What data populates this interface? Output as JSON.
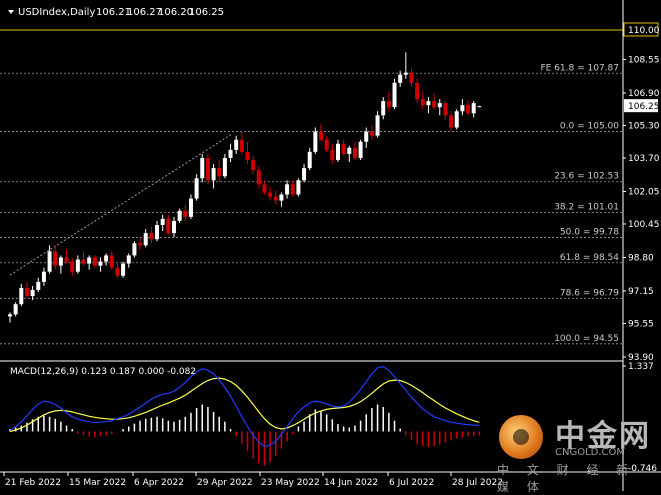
{
  "window": {
    "title": "USDIndex,Daily",
    "ohlc": [
      "106.21",
      "106.27",
      "106.20",
      "106.25"
    ]
  },
  "chart_data": {
    "type": "candlestick",
    "price_axis": {
      "ylim": [
        93.9,
        110.0
      ],
      "ticks": [
        "110.00",
        "108.55",
        "106.90",
        "105.30",
        "103.70",
        "102.05",
        "100.45",
        "98.80",
        "97.15",
        "95.55",
        "93.90"
      ],
      "current_price": "106.25"
    },
    "date_axis": {
      "ticks": [
        "21 Feb 2022",
        "15 Mar 2022",
        "6 Apr 2022",
        "29 Apr 2022",
        "23 May 2022",
        "14 Jun 2022",
        "6 Jul 2022",
        "28 Jul 2022"
      ]
    },
    "candles": [
      [
        95.9,
        96.1,
        95.6,
        96.0
      ],
      [
        96.0,
        96.6,
        95.9,
        96.5
      ],
      [
        96.5,
        97.5,
        96.4,
        97.3
      ],
      [
        97.3,
        97.6,
        96.8,
        96.9
      ],
      [
        96.9,
        97.4,
        96.7,
        97.2
      ],
      [
        97.2,
        97.8,
        97.1,
        97.6
      ],
      [
        97.6,
        98.3,
        97.4,
        98.1
      ],
      [
        98.1,
        99.4,
        98.0,
        99.1
      ],
      [
        99.1,
        99.4,
        98.2,
        98.4
      ],
      [
        98.4,
        98.9,
        98.0,
        98.8
      ],
      [
        98.8,
        99.2,
        98.5,
        98.6
      ],
      [
        98.6,
        98.8,
        97.9,
        98.1
      ],
      [
        98.1,
        98.9,
        98.0,
        98.7
      ],
      [
        98.7,
        99.1,
        98.4,
        98.5
      ],
      [
        98.5,
        98.9,
        98.2,
        98.8
      ],
      [
        98.8,
        98.9,
        98.3,
        98.4
      ],
      [
        98.4,
        98.8,
        98.1,
        98.6
      ],
      [
        98.6,
        99.0,
        98.4,
        98.9
      ],
      [
        98.9,
        99.1,
        98.2,
        98.3
      ],
      [
        98.3,
        98.5,
        97.8,
        97.9
      ],
      [
        97.9,
        98.6,
        97.8,
        98.5
      ],
      [
        98.5,
        99.0,
        98.3,
        98.9
      ],
      [
        98.9,
        99.6,
        98.8,
        99.5
      ],
      [
        99.5,
        99.8,
        99.2,
        99.4
      ],
      [
        99.4,
        100.2,
        99.3,
        100.0
      ],
      [
        100.0,
        100.3,
        99.5,
        99.7
      ],
      [
        99.7,
        100.6,
        99.6,
        100.4
      ],
      [
        100.4,
        100.9,
        100.1,
        100.7
      ],
      [
        100.7,
        100.9,
        99.9,
        100.0
      ],
      [
        100.0,
        100.8,
        99.8,
        100.6
      ],
      [
        100.6,
        101.2,
        100.5,
        101.1
      ],
      [
        101.1,
        101.4,
        100.6,
        100.8
      ],
      [
        100.8,
        101.9,
        100.7,
        101.7
      ],
      [
        101.7,
        102.9,
        101.6,
        102.7
      ],
      [
        102.7,
        103.9,
        102.5,
        103.7
      ],
      [
        103.7,
        103.9,
        102.4,
        102.6
      ],
      [
        102.6,
        103.4,
        102.2,
        103.2
      ],
      [
        103.2,
        103.6,
        102.5,
        102.8
      ],
      [
        102.8,
        103.9,
        102.7,
        103.7
      ],
      [
        103.7,
        104.4,
        103.5,
        104.1
      ],
      [
        104.1,
        104.8,
        103.9,
        104.6
      ],
      [
        104.6,
        105.0,
        103.9,
        104.0
      ],
      [
        104.0,
        104.5,
        103.4,
        103.6
      ],
      [
        103.6,
        103.8,
        102.9,
        103.1
      ],
      [
        103.1,
        103.3,
        102.2,
        102.4
      ],
      [
        102.4,
        102.6,
        101.9,
        102.0
      ],
      [
        102.0,
        102.3,
        101.6,
        101.8
      ],
      [
        101.8,
        102.1,
        101.4,
        101.6
      ],
      [
        101.6,
        102.0,
        101.3,
        101.9
      ],
      [
        101.9,
        102.6,
        101.7,
        102.4
      ],
      [
        102.4,
        102.6,
        101.8,
        101.9
      ],
      [
        101.9,
        102.7,
        101.8,
        102.6
      ],
      [
        102.6,
        103.4,
        102.5,
        103.2
      ],
      [
        103.2,
        104.2,
        103.1,
        104.0
      ],
      [
        104.0,
        105.2,
        103.9,
        105.0
      ],
      [
        105.0,
        105.4,
        104.5,
        104.6
      ],
      [
        104.6,
        104.8,
        104.0,
        104.1
      ],
      [
        104.1,
        104.4,
        103.4,
        103.6
      ],
      [
        103.6,
        104.6,
        103.5,
        104.4
      ],
      [
        104.4,
        104.6,
        103.8,
        103.9
      ],
      [
        103.9,
        104.3,
        103.5,
        104.2
      ],
      [
        104.2,
        104.5,
        103.6,
        103.7
      ],
      [
        103.7,
        104.6,
        103.6,
        104.5
      ],
      [
        104.5,
        105.2,
        104.2,
        105.0
      ],
      [
        105.0,
        105.3,
        104.6,
        104.8
      ],
      [
        104.8,
        106.0,
        104.7,
        105.8
      ],
      [
        105.8,
        106.7,
        105.6,
        106.5
      ],
      [
        106.5,
        107.0,
        106.0,
        106.2
      ],
      [
        106.2,
        107.6,
        106.1,
        107.4
      ],
      [
        107.4,
        108.0,
        107.2,
        107.8
      ],
      [
        107.8,
        108.9,
        107.6,
        107.9
      ],
      [
        107.9,
        108.1,
        107.2,
        107.4
      ],
      [
        107.4,
        107.6,
        106.4,
        106.6
      ],
      [
        106.6,
        107.0,
        106.1,
        106.3
      ],
      [
        106.3,
        106.7,
        105.9,
        106.5
      ],
      [
        106.5,
        106.9,
        106.1,
        106.2
      ],
      [
        106.2,
        106.6,
        105.8,
        106.4
      ],
      [
        106.4,
        106.5,
        105.6,
        105.8
      ],
      [
        105.8,
        106.0,
        105.0,
        105.2
      ],
      [
        105.2,
        106.1,
        105.1,
        106.0
      ],
      [
        106.0,
        106.6,
        105.8,
        106.3
      ],
      [
        106.3,
        106.5,
        105.8,
        105.9
      ],
      [
        105.9,
        106.5,
        105.7,
        106.4
      ],
      [
        106.21,
        106.27,
        106.2,
        106.25
      ]
    ],
    "fibonacci": [
      {
        "label": "FE 61.8 = 107.87",
        "value": 107.87
      },
      {
        "label": "0.0 = 105.00",
        "value": 105.0
      },
      {
        "label": "23.6 = 102.53",
        "value": 102.53
      },
      {
        "label": "38.2 = 101.01",
        "value": 101.01
      },
      {
        "label": "50.0 = 99.78",
        "value": 99.78
      },
      {
        "label": "61.8 = 98.54",
        "value": 98.54
      },
      {
        "label": "78.6 = 96.79",
        "value": 96.79
      },
      {
        "label": "100.0 = 94.55",
        "value": 94.55
      }
    ],
    "macd": {
      "label": "MACD(12,26,9) 0.123 0.187 0.000 -0.082",
      "ylim": [
        -0.746,
        1.337
      ],
      "ticks": [
        "1.337",
        "-0.746"
      ],
      "histogram": [
        0.05,
        0.08,
        0.12,
        0.18,
        0.25,
        0.3,
        0.32,
        0.3,
        0.26,
        0.2,
        0.12,
        0.05,
        -0.04,
        -0.08,
        -0.1,
        -0.12,
        -0.1,
        -0.08,
        -0.05,
        0.0,
        0.05,
        0.1,
        0.16,
        0.22,
        0.26,
        0.28,
        0.3,
        0.27,
        0.22,
        0.2,
        0.24,
        0.3,
        0.38,
        0.48,
        0.55,
        0.5,
        0.4,
        0.3,
        0.2,
        0.05,
        -0.1,
        -0.25,
        -0.4,
        -0.55,
        -0.65,
        -0.7,
        -0.62,
        -0.5,
        -0.35,
        -0.2,
        -0.05,
        0.1,
        0.2,
        0.35,
        0.45,
        0.42,
        0.35,
        0.25,
        0.15,
        0.1,
        0.08,
        0.12,
        0.22,
        0.35,
        0.48,
        0.55,
        0.5,
        0.38,
        0.22,
        0.06,
        -0.08,
        -0.18,
        -0.26,
        -0.3,
        -0.32,
        -0.3,
        -0.27,
        -0.22,
        -0.18,
        -0.14,
        -0.12,
        -0.1,
        -0.09,
        -0.082
      ],
      "macd_line": [
        0.02,
        0.1,
        0.2,
        0.32,
        0.45,
        0.56,
        0.62,
        0.6,
        0.55,
        0.48,
        0.38,
        0.3,
        0.25,
        0.22,
        0.2,
        0.18,
        0.19,
        0.2,
        0.22,
        0.26,
        0.3,
        0.35,
        0.42,
        0.5,
        0.58,
        0.66,
        0.72,
        0.76,
        0.78,
        0.82,
        0.9,
        1.0,
        1.12,
        1.22,
        1.28,
        1.25,
        1.18,
        1.05,
        0.9,
        0.72,
        0.52,
        0.3,
        0.1,
        -0.08,
        -0.22,
        -0.3,
        -0.28,
        -0.2,
        -0.06,
        0.1,
        0.26,
        0.4,
        0.5,
        0.58,
        0.62,
        0.6,
        0.56,
        0.52,
        0.5,
        0.52,
        0.6,
        0.72,
        0.86,
        1.02,
        1.18,
        1.3,
        1.32,
        1.25,
        1.12,
        0.98,
        0.84,
        0.7,
        0.58,
        0.46,
        0.38,
        0.3,
        0.26,
        0.22,
        0.19,
        0.17,
        0.15,
        0.14,
        0.13,
        0.123
      ],
      "signal_line": [
        0.0,
        0.03,
        0.07,
        0.13,
        0.2,
        0.27,
        0.34,
        0.39,
        0.42,
        0.43,
        0.42,
        0.4,
        0.37,
        0.34,
        0.31,
        0.29,
        0.27,
        0.26,
        0.25,
        0.25,
        0.26,
        0.28,
        0.31,
        0.35,
        0.39,
        0.44,
        0.49,
        0.54,
        0.58,
        0.63,
        0.68,
        0.74,
        0.82,
        0.9,
        0.98,
        1.04,
        1.08,
        1.09,
        1.07,
        1.02,
        0.94,
        0.83,
        0.7,
        0.55,
        0.4,
        0.26,
        0.15,
        0.08,
        0.05,
        0.07,
        0.12,
        0.18,
        0.25,
        0.32,
        0.38,
        0.42,
        0.45,
        0.47,
        0.48,
        0.49,
        0.51,
        0.55,
        0.61,
        0.69,
        0.78,
        0.88,
        0.97,
        1.03,
        1.05,
        1.04,
        1.0,
        0.94,
        0.87,
        0.79,
        0.71,
        0.63,
        0.55,
        0.48,
        0.42,
        0.36,
        0.31,
        0.26,
        0.22,
        0.187
      ]
    }
  },
  "watermark": {
    "brand_cn": "中金网",
    "brand_en": "CNGOLD.COM",
    "tagline": "中 文 财 经 新 媒 体"
  },
  "colors": {
    "background": "#000000",
    "bull": "#ffffff",
    "bear": "#d10000",
    "grid_line": "#9a9a9a",
    "macd": "#1f3bff",
    "signal": "#ffff4d",
    "price_tag_border": "#e0c000"
  }
}
